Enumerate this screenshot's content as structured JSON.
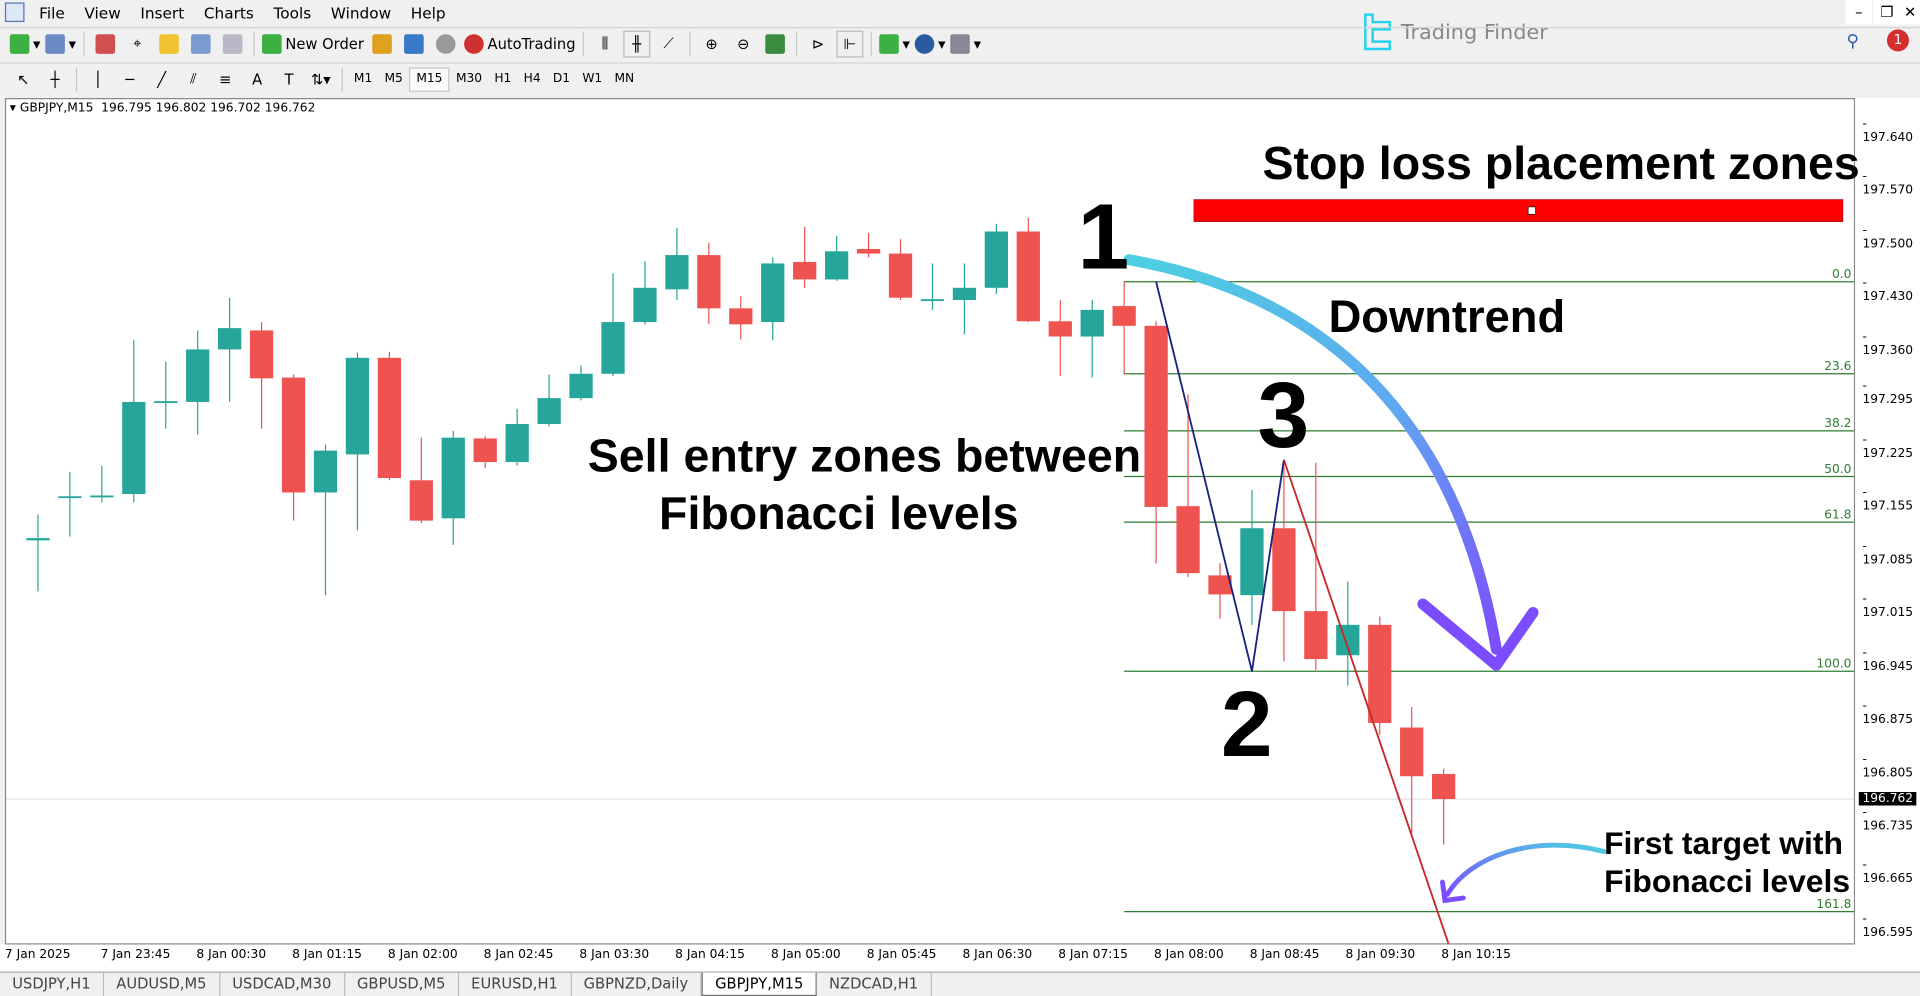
{
  "menu": [
    "File",
    "View",
    "Insert",
    "Charts",
    "Tools",
    "Window",
    "Help"
  ],
  "toolbar": {
    "new_order": "New Order",
    "autotrading": "AutoTrading"
  },
  "timeframes": [
    "M1",
    "M5",
    "M15",
    "M30",
    "H1",
    "H4",
    "D1",
    "W1",
    "MN"
  ],
  "active_timeframe": "M15",
  "logo": {
    "text": "Trading Finder",
    "color": "#22d3ee"
  },
  "notification_count": "1",
  "chart_header": {
    "symbol": "GBPJPY,M15",
    "ohlc": "196.795 196.802 196.702 196.762"
  },
  "annotations": {
    "stop_loss": "Stop loss placement zones",
    "downtrend": "Downtrend",
    "sell_line1": "Sell entry zones between",
    "sell_line2": "Fibonacci levels",
    "target_line1": "First target with",
    "target_line2": "Fibonacci levels",
    "point1": "1",
    "point2": "2",
    "point3": "3"
  },
  "tabs": [
    "USDJPY,H1",
    "AUDUSD,M5",
    "USDCAD,M30",
    "GBPUSD,M5",
    "EURUSD,H1",
    "GBPNZD,Daily",
    "GBPJPY,M15",
    "NZDCAD,H1"
  ],
  "active_tab": "GBPJPY,M15",
  "chart_data": {
    "type": "candlestick",
    "symbol": "GBPJPY",
    "timeframe": "M15",
    "colors": {
      "bull": "#26a69a",
      "bear": "#ef5350",
      "fib": "#2e7d32",
      "zigzag_up": "#1a237e",
      "zigzag_down": "#c62828",
      "stop_zone": "#ff0000"
    },
    "ylim": [
      196.57,
      197.67
    ],
    "price_ticks": [
      "197.640",
      "197.570",
      "197.500",
      "197.430",
      "197.360",
      "197.295",
      "197.225",
      "197.155",
      "197.085",
      "197.015",
      "196.945",
      "196.875",
      "196.805",
      "196.735",
      "196.665",
      "196.595"
    ],
    "current_price": "196.762",
    "time_ticks": [
      "7 Jan 2025",
      "7 Jan 23:45",
      "8 Jan 00:30",
      "8 Jan 01:15",
      "8 Jan 02:00",
      "8 Jan 02:45",
      "8 Jan 03:30",
      "8 Jan 04:15",
      "8 Jan 05:00",
      "8 Jan 05:45",
      "8 Jan 06:30",
      "8 Jan 07:15",
      "8 Jan 08:00",
      "8 Jan 08:45",
      "8 Jan 09:30",
      "8 Jan 10:15"
    ],
    "candles": [
      [
        197.102,
        197.136,
        197.035,
        197.105
      ],
      [
        197.158,
        197.192,
        197.107,
        197.16
      ],
      [
        197.159,
        197.2,
        197.152,
        197.161
      ],
      [
        197.163,
        197.365,
        197.152,
        197.284
      ],
      [
        197.284,
        197.337,
        197.249,
        197.285
      ],
      [
        197.284,
        197.378,
        197.241,
        197.353
      ],
      [
        197.353,
        197.421,
        197.284,
        197.381
      ],
      [
        197.378,
        197.389,
        197.249,
        197.315
      ],
      [
        197.316,
        197.32,
        197.128,
        197.165
      ],
      [
        197.165,
        197.228,
        197.03,
        197.22
      ],
      [
        197.215,
        197.349,
        197.115,
        197.342
      ],
      [
        197.342,
        197.35,
        197.181,
        197.184
      ],
      [
        197.181,
        197.237,
        197.125,
        197.128
      ],
      [
        197.131,
        197.246,
        197.096,
        197.237
      ],
      [
        197.236,
        197.239,
        197.197,
        197.205
      ],
      [
        197.205,
        197.275,
        197.2,
        197.255
      ],
      [
        197.255,
        197.32,
        197.252,
        197.289
      ],
      [
        197.289,
        197.332,
        197.286,
        197.321
      ],
      [
        197.321,
        197.453,
        197.318,
        197.389
      ],
      [
        197.389,
        197.469,
        197.386,
        197.434
      ],
      [
        197.432,
        197.513,
        197.418,
        197.477
      ],
      [
        197.477,
        197.493,
        197.386,
        197.407
      ],
      [
        197.407,
        197.423,
        197.366,
        197.386
      ],
      [
        197.389,
        197.474,
        197.365,
        197.466
      ],
      [
        197.468,
        197.514,
        197.434,
        197.445
      ],
      [
        197.445,
        197.502,
        197.443,
        197.482
      ],
      [
        197.485,
        197.506,
        197.474,
        197.479
      ],
      [
        197.479,
        197.498,
        197.418,
        197.421
      ],
      [
        197.418,
        197.466,
        197.405,
        197.419
      ],
      [
        197.418,
        197.466,
        197.373,
        197.434
      ],
      [
        197.434,
        197.518,
        197.426,
        197.508
      ],
      [
        197.508,
        197.526,
        197.389,
        197.39
      ],
      [
        197.39,
        197.418,
        197.318,
        197.37
      ],
      [
        197.37,
        197.418,
        197.316,
        197.405
      ],
      [
        197.41,
        197.442,
        197.32,
        197.384
      ],
      [
        197.384,
        197.39,
        197.072,
        197.146
      ],
      [
        197.147,
        197.294,
        197.054,
        197.059
      ],
      [
        197.056,
        197.072,
        196.999,
        197.031
      ],
      [
        197.03,
        197.168,
        196.991,
        197.118
      ],
      [
        197.118,
        197.204,
        196.943,
        197.009
      ],
      [
        197.009,
        197.204,
        196.932,
        196.946
      ],
      [
        196.951,
        197.048,
        196.911,
        196.991
      ],
      [
        196.991,
        197.002,
        196.846,
        196.862
      ],
      [
        196.856,
        196.883,
        196.717,
        196.792
      ],
      [
        196.795,
        196.802,
        196.702,
        196.762
      ]
    ],
    "fibonacci": [
      {
        "level": "0.0",
        "price": 197.442
      },
      {
        "level": "23.6",
        "price": 197.321
      },
      {
        "level": "38.2",
        "price": 197.246
      },
      {
        "level": "50.0",
        "price": 197.186
      },
      {
        "level": "61.8",
        "price": 197.126
      },
      {
        "level": "100.0",
        "price": 196.93
      },
      {
        "level": "161.8",
        "price": 196.614
      }
    ],
    "zigzag": [
      [
        35,
        197.442
      ],
      [
        38,
        196.93
      ],
      [
        39,
        197.208
      ],
      [
        44.15,
        196.572
      ]
    ],
    "stop_loss_zone": [
      197.521,
      197.55
    ]
  }
}
